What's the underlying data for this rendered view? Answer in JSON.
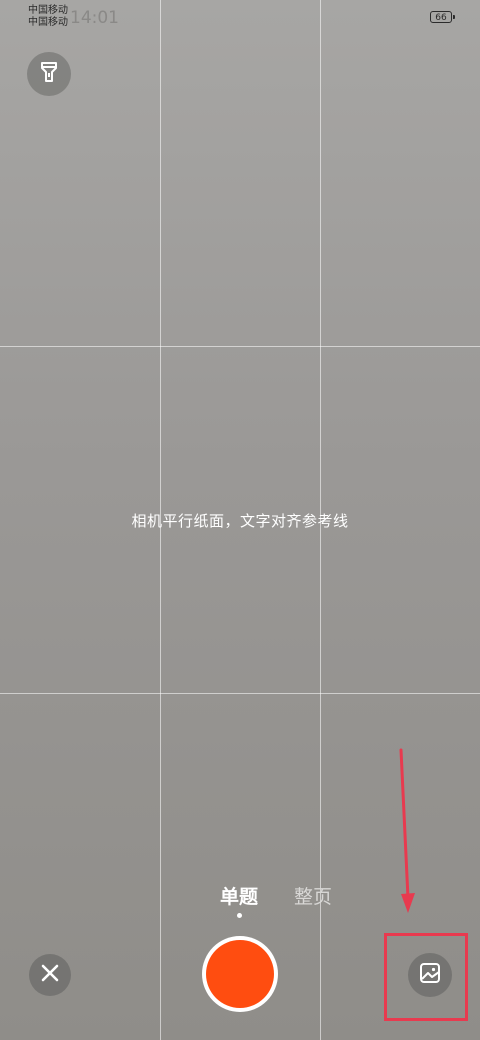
{
  "status_bar": {
    "carrier_1": "中国移动",
    "carrier_2": "中国移动",
    "time": "14:01",
    "battery": "66"
  },
  "camera": {
    "guide_text": "相机平行纸面，文字对齐参考线",
    "modes": {
      "active": "单题",
      "inactive": "整页"
    }
  },
  "icons": {
    "flashlight": "flashlight-icon",
    "close": "close-icon",
    "gallery": "gallery-icon"
  },
  "colors": {
    "shutter": "#ff4d10",
    "annotation": "#e83a4f"
  }
}
